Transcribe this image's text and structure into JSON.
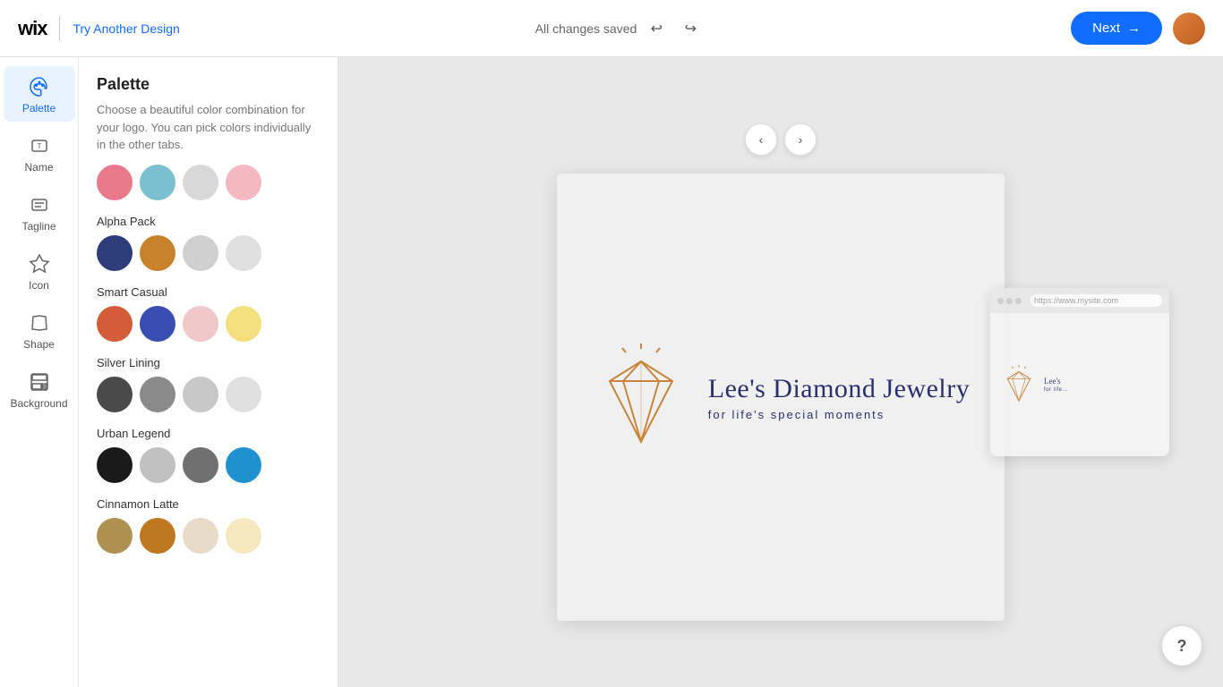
{
  "header": {
    "logo_text": "wix",
    "try_another_design": "Try Another Design",
    "status": "All changes saved",
    "next_label": "Next",
    "undo_icon": "↩",
    "redo_icon": "↪",
    "arrow_icon": "→"
  },
  "sidebar": {
    "items": [
      {
        "id": "palette",
        "label": "Palette",
        "active": true
      },
      {
        "id": "name",
        "label": "Name",
        "active": false
      },
      {
        "id": "tagline",
        "label": "Tagline",
        "active": false
      },
      {
        "id": "icon",
        "label": "Icon",
        "active": false
      },
      {
        "id": "shape",
        "label": "Shape",
        "active": false
      },
      {
        "id": "background",
        "label": "Background",
        "active": false
      }
    ]
  },
  "palette_panel": {
    "title": "Palette",
    "description": "Choose a beautiful color combination for your logo. You can pick colors individually in the other tabs.",
    "groups": [
      {
        "name": "",
        "swatches": [
          "#e8798c",
          "#7cbfd0",
          "#d8d8d8",
          "#f5b8c0"
        ]
      },
      {
        "name": "Alpha Pack",
        "swatches": [
          "#2c3d7a",
          "#c9822a",
          "#d0d0d0",
          "#e0e0e0"
        ]
      },
      {
        "name": "Smart Casual",
        "swatches": [
          "#d45c38",
          "#3a4db0",
          "#f0c8c8",
          "#f5e080"
        ]
      },
      {
        "name": "Silver Lining",
        "swatches": [
          "#4a4a4a",
          "#8a8a8a",
          "#c8c8c8",
          "#e0e0e0"
        ]
      },
      {
        "name": "Urban Legend",
        "swatches": [
          "#1a1a1a",
          "#c0c0c0",
          "#707070",
          "#2090d0"
        ]
      },
      {
        "name": "Cinnamon Latte",
        "swatches": [
          "#b09050",
          "#c07820",
          "#e8dcc8",
          "#f5e8c0"
        ]
      }
    ]
  },
  "logo": {
    "main_text": "Lee's Diamond Jewelry",
    "sub_text": "for life's special moments",
    "diamond_color": "#c8843a"
  },
  "browser_preview": {
    "url": "https://www.mysite.com",
    "mini_main": "Lee's",
    "mini_sub": "for life..."
  },
  "help_label": "?",
  "nav": {
    "prev": "‹",
    "next": "›"
  }
}
